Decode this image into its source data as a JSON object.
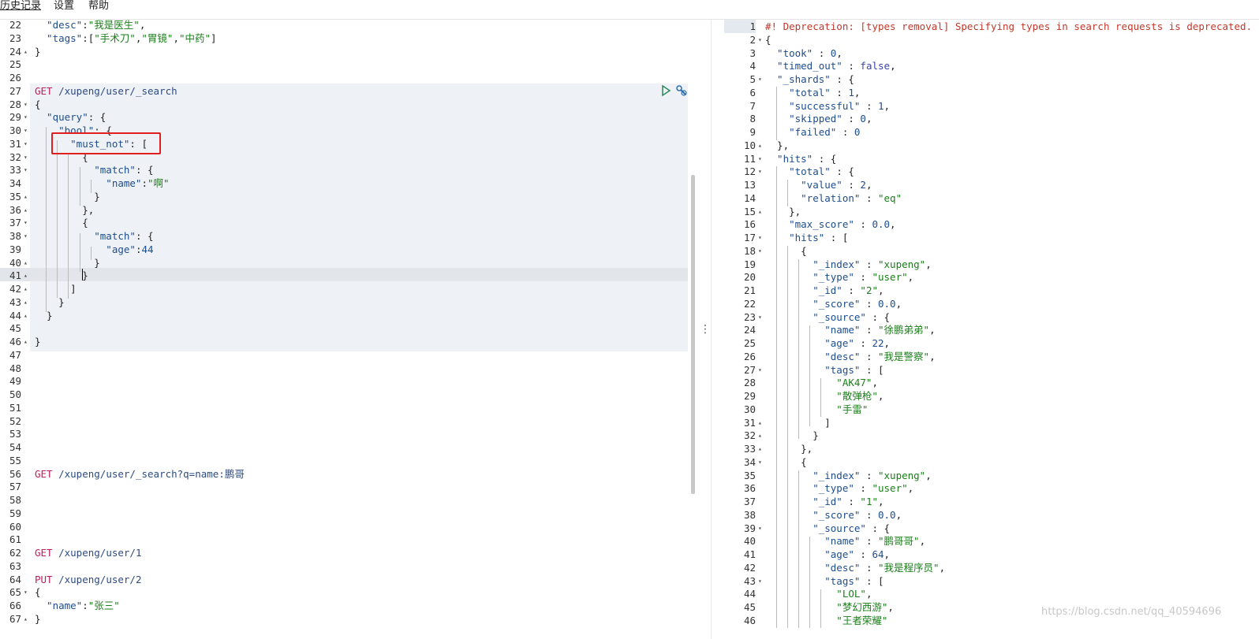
{
  "menu": {
    "history": "历史记录",
    "settings": "设置",
    "help": "帮助"
  },
  "left_lines": [
    {
      "n": "22",
      "f": "",
      "c": [
        [
          "tk-key",
          "  \"desc\""
        ],
        [
          "tk-punc",
          ":"
        ],
        [
          "tk-str",
          "\"我是医生\""
        ],
        [
          "tk-punc",
          ","
        ]
      ]
    },
    {
      "n": "23",
      "f": "",
      "c": [
        [
          "tk-key",
          "  \"tags\""
        ],
        [
          "tk-punc",
          ":["
        ],
        [
          "tk-str",
          "\"手术刀\""
        ],
        [
          "tk-punc",
          ","
        ],
        [
          "tk-str",
          "\"胃镜\""
        ],
        [
          "tk-punc",
          ","
        ],
        [
          "tk-str",
          "\"中药\""
        ],
        [
          "tk-punc",
          "]"
        ]
      ]
    },
    {
      "n": "24",
      "f": "▴",
      "c": [
        [
          "tk-punc",
          "}"
        ]
      ]
    },
    {
      "n": "25",
      "f": "",
      "c": []
    },
    {
      "n": "26",
      "f": "",
      "c": []
    },
    {
      "n": "27",
      "f": "",
      "c": [
        [
          "tk-method",
          "GET"
        ],
        [
          "tk-punc",
          " "
        ],
        [
          "tk-url",
          "/xupeng/user/_search"
        ]
      ]
    },
    {
      "n": "28",
      "f": "▾",
      "c": [
        [
          "tk-punc",
          "{"
        ]
      ]
    },
    {
      "n": "29",
      "f": "▾",
      "c": [
        [
          "tk-key",
          "  \"query\""
        ],
        [
          "tk-punc",
          ": {"
        ]
      ]
    },
    {
      "n": "30",
      "f": "▾",
      "c": [
        [
          "tk-key",
          "    \"bool\""
        ],
        [
          "tk-punc",
          ": {"
        ]
      ]
    },
    {
      "n": "31",
      "f": "▾",
      "c": [
        [
          "tk-key",
          "      \"must_not\""
        ],
        [
          "tk-punc",
          ": ["
        ]
      ]
    },
    {
      "n": "32",
      "f": "▾",
      "c": [
        [
          "tk-punc",
          "        {"
        ]
      ]
    },
    {
      "n": "33",
      "f": "▾",
      "c": [
        [
          "tk-key",
          "          \"match\""
        ],
        [
          "tk-punc",
          ": {"
        ]
      ]
    },
    {
      "n": "34",
      "f": "",
      "c": [
        [
          "tk-key",
          "            \"name\""
        ],
        [
          "tk-punc",
          ":"
        ],
        [
          "tk-str",
          "\"啊\""
        ]
      ]
    },
    {
      "n": "35",
      "f": "▴",
      "c": [
        [
          "tk-punc",
          "          }"
        ]
      ]
    },
    {
      "n": "36",
      "f": "▴",
      "c": [
        [
          "tk-punc",
          "        },"
        ]
      ]
    },
    {
      "n": "37",
      "f": "▾",
      "c": [
        [
          "tk-punc",
          "        {"
        ]
      ]
    },
    {
      "n": "38",
      "f": "▾",
      "c": [
        [
          "tk-key",
          "          \"match\""
        ],
        [
          "tk-punc",
          ": {"
        ]
      ]
    },
    {
      "n": "39",
      "f": "",
      "c": [
        [
          "tk-key",
          "            \"age\""
        ],
        [
          "tk-punc",
          ":"
        ],
        [
          "tk-num",
          "44"
        ]
      ]
    },
    {
      "n": "40",
      "f": "▴",
      "c": [
        [
          "tk-punc",
          "          }"
        ]
      ]
    },
    {
      "n": "41",
      "f": "▴",
      "c": [
        [
          "tk-punc",
          "        }"
        ]
      ]
    },
    {
      "n": "42",
      "f": "▴",
      "c": [
        [
          "tk-punc",
          "      ]"
        ]
      ]
    },
    {
      "n": "43",
      "f": "▴",
      "c": [
        [
          "tk-punc",
          "    }"
        ]
      ]
    },
    {
      "n": "44",
      "f": "▴",
      "c": [
        [
          "tk-punc",
          "  }"
        ]
      ]
    },
    {
      "n": "45",
      "f": "",
      "c": []
    },
    {
      "n": "46",
      "f": "▴",
      "c": [
        [
          "tk-punc",
          "}"
        ]
      ]
    },
    {
      "n": "47",
      "f": "",
      "c": []
    },
    {
      "n": "48",
      "f": "",
      "c": []
    },
    {
      "n": "49",
      "f": "",
      "c": []
    },
    {
      "n": "50",
      "f": "",
      "c": []
    },
    {
      "n": "51",
      "f": "",
      "c": []
    },
    {
      "n": "52",
      "f": "",
      "c": []
    },
    {
      "n": "53",
      "f": "",
      "c": []
    },
    {
      "n": "54",
      "f": "",
      "c": []
    },
    {
      "n": "55",
      "f": "",
      "c": []
    },
    {
      "n": "56",
      "f": "",
      "c": [
        [
          "tk-method",
          "GET"
        ],
        [
          "tk-punc",
          " "
        ],
        [
          "tk-url",
          "/xupeng/user/_search?q=name:鹏哥"
        ]
      ]
    },
    {
      "n": "57",
      "f": "",
      "c": []
    },
    {
      "n": "58",
      "f": "",
      "c": []
    },
    {
      "n": "59",
      "f": "",
      "c": []
    },
    {
      "n": "60",
      "f": "",
      "c": []
    },
    {
      "n": "61",
      "f": "",
      "c": []
    },
    {
      "n": "62",
      "f": "",
      "c": [
        [
          "tk-method",
          "GET"
        ],
        [
          "tk-punc",
          " "
        ],
        [
          "tk-url",
          "/xupeng/user/1"
        ]
      ]
    },
    {
      "n": "63",
      "f": "",
      "c": []
    },
    {
      "n": "64",
      "f": "",
      "c": [
        [
          "tk-method",
          "PUT"
        ],
        [
          "tk-punc",
          " "
        ],
        [
          "tk-url",
          "/xupeng/user/2"
        ]
      ]
    },
    {
      "n": "65",
      "f": "▾",
      "c": [
        [
          "tk-punc",
          "{"
        ]
      ]
    },
    {
      "n": "66",
      "f": "",
      "c": [
        [
          "tk-key",
          "  \"name\""
        ],
        [
          "tk-punc",
          ":"
        ],
        [
          "tk-str",
          "\"张三\""
        ]
      ]
    },
    {
      "n": "67",
      "f": "▴",
      "c": [
        [
          "tk-punc",
          "}"
        ]
      ]
    }
  ],
  "right_lines": [
    {
      "n": "1",
      "f": "",
      "c": [
        [
          "tk-warn",
          "#! Deprecation: [types removal] Specifying types in search requests is deprecated."
        ]
      ]
    },
    {
      "n": "2",
      "f": "▾",
      "c": [
        [
          "tk-punc",
          "{"
        ]
      ]
    },
    {
      "n": "3",
      "f": "",
      "c": [
        [
          "tk-key",
          "  \"took\""
        ],
        [
          "tk-punc",
          " : "
        ],
        [
          "tk-num",
          "0"
        ],
        [
          "tk-punc",
          ","
        ]
      ]
    },
    {
      "n": "4",
      "f": "",
      "c": [
        [
          "tk-key",
          "  \"timed_out\""
        ],
        [
          "tk-punc",
          " : "
        ],
        [
          "tk-bool",
          "false"
        ],
        [
          "tk-punc",
          ","
        ]
      ]
    },
    {
      "n": "5",
      "f": "▾",
      "c": [
        [
          "tk-key",
          "  \"_shards\""
        ],
        [
          "tk-punc",
          " : {"
        ]
      ]
    },
    {
      "n": "6",
      "f": "",
      "c": [
        [
          "tk-key",
          "    \"total\""
        ],
        [
          "tk-punc",
          " : "
        ],
        [
          "tk-num",
          "1"
        ],
        [
          "tk-punc",
          ","
        ]
      ]
    },
    {
      "n": "7",
      "f": "",
      "c": [
        [
          "tk-key",
          "    \"successful\""
        ],
        [
          "tk-punc",
          " : "
        ],
        [
          "tk-num",
          "1"
        ],
        [
          "tk-punc",
          ","
        ]
      ]
    },
    {
      "n": "8",
      "f": "",
      "c": [
        [
          "tk-key",
          "    \"skipped\""
        ],
        [
          "tk-punc",
          " : "
        ],
        [
          "tk-num",
          "0"
        ],
        [
          "tk-punc",
          ","
        ]
      ]
    },
    {
      "n": "9",
      "f": "",
      "c": [
        [
          "tk-key",
          "    \"failed\""
        ],
        [
          "tk-punc",
          " : "
        ],
        [
          "tk-num",
          "0"
        ]
      ]
    },
    {
      "n": "10",
      "f": "▴",
      "c": [
        [
          "tk-punc",
          "  },"
        ]
      ]
    },
    {
      "n": "11",
      "f": "▾",
      "c": [
        [
          "tk-key",
          "  \"hits\""
        ],
        [
          "tk-punc",
          " : {"
        ]
      ]
    },
    {
      "n": "12",
      "f": "▾",
      "c": [
        [
          "tk-key",
          "    \"total\""
        ],
        [
          "tk-punc",
          " : {"
        ]
      ]
    },
    {
      "n": "13",
      "f": "",
      "c": [
        [
          "tk-key",
          "      \"value\""
        ],
        [
          "tk-punc",
          " : "
        ],
        [
          "tk-num",
          "2"
        ],
        [
          "tk-punc",
          ","
        ]
      ]
    },
    {
      "n": "14",
      "f": "",
      "c": [
        [
          "tk-key",
          "      \"relation\""
        ],
        [
          "tk-punc",
          " : "
        ],
        [
          "tk-str",
          "\"eq\""
        ]
      ]
    },
    {
      "n": "15",
      "f": "▴",
      "c": [
        [
          "tk-punc",
          "    },"
        ]
      ]
    },
    {
      "n": "16",
      "f": "",
      "c": [
        [
          "tk-key",
          "    \"max_score\""
        ],
        [
          "tk-punc",
          " : "
        ],
        [
          "tk-num",
          "0.0"
        ],
        [
          "tk-punc",
          ","
        ]
      ]
    },
    {
      "n": "17",
      "f": "▾",
      "c": [
        [
          "tk-key",
          "    \"hits\""
        ],
        [
          "tk-punc",
          " : ["
        ]
      ]
    },
    {
      "n": "18",
      "f": "▾",
      "c": [
        [
          "tk-punc",
          "      {"
        ]
      ]
    },
    {
      "n": "19",
      "f": "",
      "c": [
        [
          "tk-key",
          "        \"_index\""
        ],
        [
          "tk-punc",
          " : "
        ],
        [
          "tk-str",
          "\"xupeng\""
        ],
        [
          "tk-punc",
          ","
        ]
      ]
    },
    {
      "n": "20",
      "f": "",
      "c": [
        [
          "tk-key",
          "        \"_type\""
        ],
        [
          "tk-punc",
          " : "
        ],
        [
          "tk-str",
          "\"user\""
        ],
        [
          "tk-punc",
          ","
        ]
      ]
    },
    {
      "n": "21",
      "f": "",
      "c": [
        [
          "tk-key",
          "        \"_id\""
        ],
        [
          "tk-punc",
          " : "
        ],
        [
          "tk-str",
          "\"2\""
        ],
        [
          "tk-punc",
          ","
        ]
      ]
    },
    {
      "n": "22",
      "f": "",
      "c": [
        [
          "tk-key",
          "        \"_score\""
        ],
        [
          "tk-punc",
          " : "
        ],
        [
          "tk-num",
          "0.0"
        ],
        [
          "tk-punc",
          ","
        ]
      ]
    },
    {
      "n": "23",
      "f": "▾",
      "c": [
        [
          "tk-key",
          "        \"_source\""
        ],
        [
          "tk-punc",
          " : {"
        ]
      ]
    },
    {
      "n": "24",
      "f": "",
      "c": [
        [
          "tk-key",
          "          \"name\""
        ],
        [
          "tk-punc",
          " : "
        ],
        [
          "tk-str",
          "\"徐鹏弟弟\""
        ],
        [
          "tk-punc",
          ","
        ]
      ]
    },
    {
      "n": "25",
      "f": "",
      "c": [
        [
          "tk-key",
          "          \"age\""
        ],
        [
          "tk-punc",
          " : "
        ],
        [
          "tk-num",
          "22"
        ],
        [
          "tk-punc",
          ","
        ]
      ]
    },
    {
      "n": "26",
      "f": "",
      "c": [
        [
          "tk-key",
          "          \"desc\""
        ],
        [
          "tk-punc",
          " : "
        ],
        [
          "tk-str",
          "\"我是警察\""
        ],
        [
          "tk-punc",
          ","
        ]
      ]
    },
    {
      "n": "27",
      "f": "▾",
      "c": [
        [
          "tk-key",
          "          \"tags\""
        ],
        [
          "tk-punc",
          " : ["
        ]
      ]
    },
    {
      "n": "28",
      "f": "",
      "c": [
        [
          "tk-str",
          "            \"AK47\""
        ],
        [
          "tk-punc",
          ","
        ]
      ]
    },
    {
      "n": "29",
      "f": "",
      "c": [
        [
          "tk-str",
          "            \"散弹枪\""
        ],
        [
          "tk-punc",
          ","
        ]
      ]
    },
    {
      "n": "30",
      "f": "",
      "c": [
        [
          "tk-str",
          "            \"手雷\""
        ]
      ]
    },
    {
      "n": "31",
      "f": "▴",
      "c": [
        [
          "tk-punc",
          "          ]"
        ]
      ]
    },
    {
      "n": "32",
      "f": "▴",
      "c": [
        [
          "tk-punc",
          "        }"
        ]
      ]
    },
    {
      "n": "33",
      "f": "▴",
      "c": [
        [
          "tk-punc",
          "      },"
        ]
      ]
    },
    {
      "n": "34",
      "f": "▾",
      "c": [
        [
          "tk-punc",
          "      {"
        ]
      ]
    },
    {
      "n": "35",
      "f": "",
      "c": [
        [
          "tk-key",
          "        \"_index\""
        ],
        [
          "tk-punc",
          " : "
        ],
        [
          "tk-str",
          "\"xupeng\""
        ],
        [
          "tk-punc",
          ","
        ]
      ]
    },
    {
      "n": "36",
      "f": "",
      "c": [
        [
          "tk-key",
          "        \"_type\""
        ],
        [
          "tk-punc",
          " : "
        ],
        [
          "tk-str",
          "\"user\""
        ],
        [
          "tk-punc",
          ","
        ]
      ]
    },
    {
      "n": "37",
      "f": "",
      "c": [
        [
          "tk-key",
          "        \"_id\""
        ],
        [
          "tk-punc",
          " : "
        ],
        [
          "tk-str",
          "\"1\""
        ],
        [
          "tk-punc",
          ","
        ]
      ]
    },
    {
      "n": "38",
      "f": "",
      "c": [
        [
          "tk-key",
          "        \"_score\""
        ],
        [
          "tk-punc",
          " : "
        ],
        [
          "tk-num",
          "0.0"
        ],
        [
          "tk-punc",
          ","
        ]
      ]
    },
    {
      "n": "39",
      "f": "▾",
      "c": [
        [
          "tk-key",
          "        \"_source\""
        ],
        [
          "tk-punc",
          " : {"
        ]
      ]
    },
    {
      "n": "40",
      "f": "",
      "c": [
        [
          "tk-key",
          "          \"name\""
        ],
        [
          "tk-punc",
          " : "
        ],
        [
          "tk-str",
          "\"鹏哥哥\""
        ],
        [
          "tk-punc",
          ","
        ]
      ]
    },
    {
      "n": "41",
      "f": "",
      "c": [
        [
          "tk-key",
          "          \"age\""
        ],
        [
          "tk-punc",
          " : "
        ],
        [
          "tk-num",
          "64"
        ],
        [
          "tk-punc",
          ","
        ]
      ]
    },
    {
      "n": "42",
      "f": "",
      "c": [
        [
          "tk-key",
          "          \"desc\""
        ],
        [
          "tk-punc",
          " : "
        ],
        [
          "tk-str",
          "\"我是程序员\""
        ],
        [
          "tk-punc",
          ","
        ]
      ]
    },
    {
      "n": "43",
      "f": "▾",
      "c": [
        [
          "tk-key",
          "          \"tags\""
        ],
        [
          "tk-punc",
          " : ["
        ]
      ]
    },
    {
      "n": "44",
      "f": "",
      "c": [
        [
          "tk-str",
          "            \"LOL\""
        ],
        [
          "tk-punc",
          ","
        ]
      ]
    },
    {
      "n": "45",
      "f": "",
      "c": [
        [
          "tk-str",
          "            \"梦幻西游\""
        ],
        [
          "tk-punc",
          ","
        ]
      ]
    },
    {
      "n": "46",
      "f": "",
      "c": [
        [
          "tk-str",
          "            \"王者荣耀\""
        ]
      ]
    }
  ],
  "icons": {
    "run": "play-icon",
    "settings": "wrench-icon",
    "splitter": "vertical-ellipsis-icon"
  },
  "splitter_glyph": "⋮",
  "watermark": "https://blog.csdn.net/qq_40594696",
  "colors": {
    "highlight_box": "#e01f1f",
    "request_bg": "#eef1f5",
    "active_line": "#e2e6ea"
  }
}
